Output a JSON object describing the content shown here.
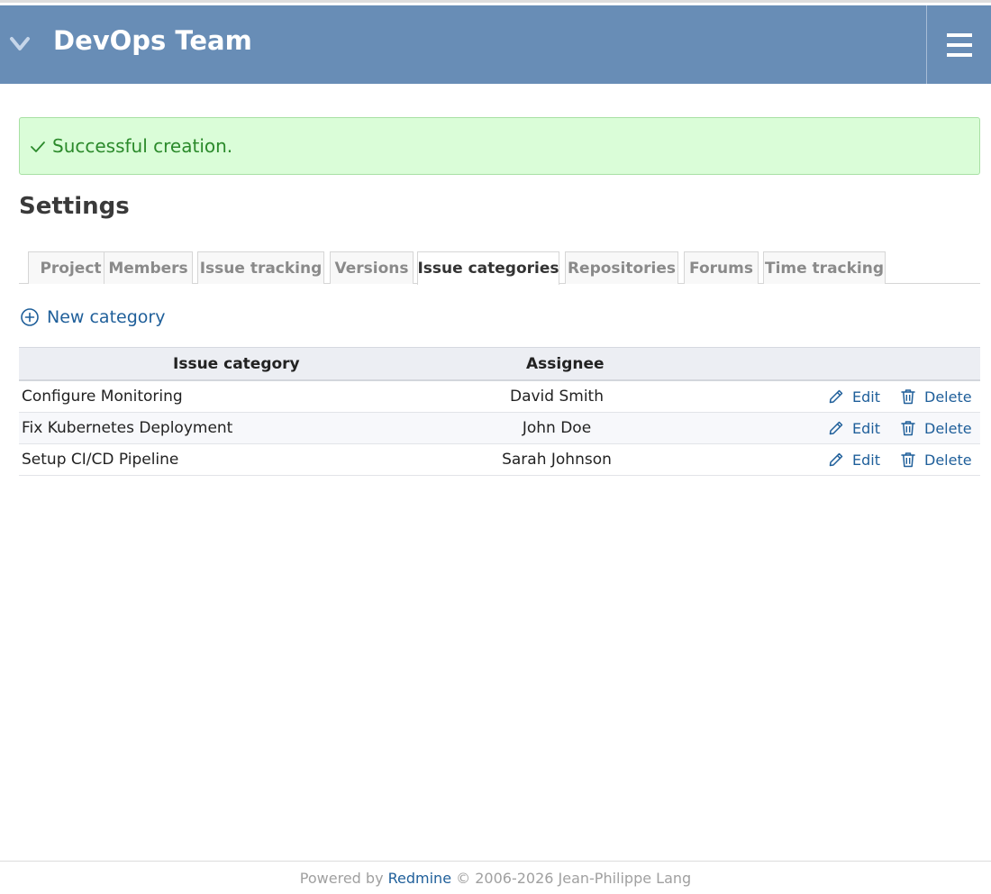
{
  "header": {
    "title": "DevOps Team",
    "expand_icon": "chevron-down-icon",
    "menu_icon": "hamburger-icon",
    "background": "#688db6"
  },
  "flash": {
    "message": "Successful creation.",
    "icon": "check-icon",
    "color": "#2b8a2b"
  },
  "page": {
    "title": "Settings"
  },
  "tabs": [
    {
      "label": "Project"
    },
    {
      "label": "Members"
    },
    {
      "label": "Issue tracking"
    },
    {
      "label": "Versions"
    },
    {
      "label": "Issue categories",
      "selected": true
    },
    {
      "label": "Repositories"
    },
    {
      "label": "Forums"
    },
    {
      "label": "Time tracking"
    }
  ],
  "new_category": {
    "label": "New category",
    "icon": "add-circle-icon"
  },
  "table": {
    "columns": [
      "Issue category",
      "Assignee"
    ],
    "rows": [
      {
        "category": "Configure Monitoring",
        "assignee": "David Smith",
        "edit": "Edit",
        "delete": "Delete"
      },
      {
        "category": "Fix Kubernetes Deployment",
        "assignee": "John Doe",
        "edit": "Edit",
        "delete": "Delete"
      },
      {
        "category": "Setup CI/CD Pipeline",
        "assignee": "Sarah Johnson",
        "edit": "Edit",
        "delete": "Delete"
      }
    ]
  },
  "footer": {
    "prefix": "Powered by ",
    "link": "Redmine",
    "suffix": " © 2006-2026 Jean-Philippe Lang"
  }
}
